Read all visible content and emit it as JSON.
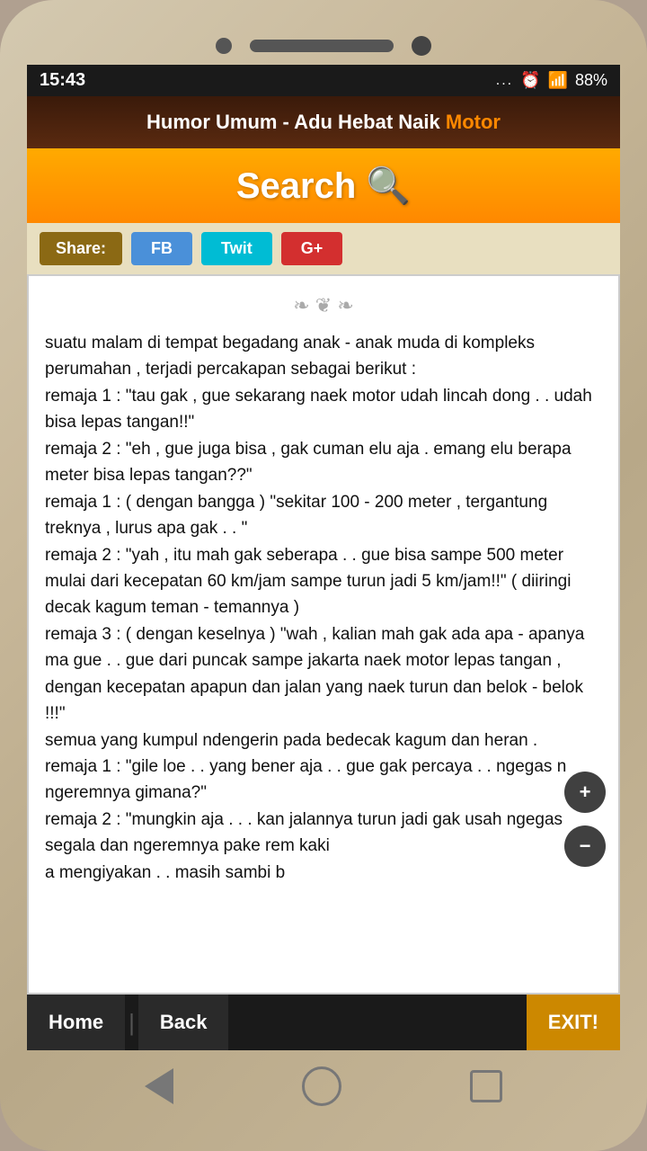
{
  "status": {
    "time": "15:43",
    "dots": "...",
    "signal": "📶",
    "battery": "88%"
  },
  "header": {
    "title": "Humor Umum - Adu Hebat Naik ",
    "highlight": "Motor"
  },
  "search": {
    "label": "Search 🔍"
  },
  "share": {
    "label": "Share:",
    "fb": "FB",
    "twit": "Twit",
    "gplus": "G+"
  },
  "content": {
    "ornament": "❧ ❦ ❧",
    "text": " suatu malam di tempat begadang anak - anak muda di kompleks perumahan , terjadi percakapan sebagai berikut :\nremaja 1 : \"tau gak , gue sekarang naek motor udah lincah dong . . udah bisa lepas tangan!!\"\nremaja 2 : \"eh , gue juga bisa , gak cuman elu aja . emang elu berapa meter bisa lepas tangan??\"\nremaja 1 : ( dengan bangga ) \"sekitar 100 - 200 meter , tergantung treknya , lurus apa gak . . \"\nremaja 2 : \"yah , itu mah gak seberapa . . gue bisa sampe 500 meter mulai dari kecepatan 60 km/jam sampe turun jadi 5 km/jam!!\" ( diiringi decak kagum teman - temannya )\nremaja 3 : ( dengan keselnya ) \"wah , kalian mah gak ada apa - apanya ma gue . . gue dari puncak sampe jakarta naek motor lepas tangan , dengan kecepatan apapun dan jalan yang naek turun dan belok - belok !!!\"\nsemua yang kumpul ndengerin pada bedecak kagum dan heran .\nremaja 1 : \"gile loe . . yang bener aja . . gue gak percaya . . ngegas n ngeremnya gimana?\"\nremaja 2 : \"mungkin aja . . . kan jalannya turun jadi gak usah ngegas segala dan ngeremnya pake rem kaki\na mengiyakan . . masih sambi b"
  },
  "zoom": {
    "plus": "+",
    "minus": "−"
  },
  "bottomNav": {
    "home": "Home",
    "back": "Back",
    "exit": "EXIT!"
  }
}
